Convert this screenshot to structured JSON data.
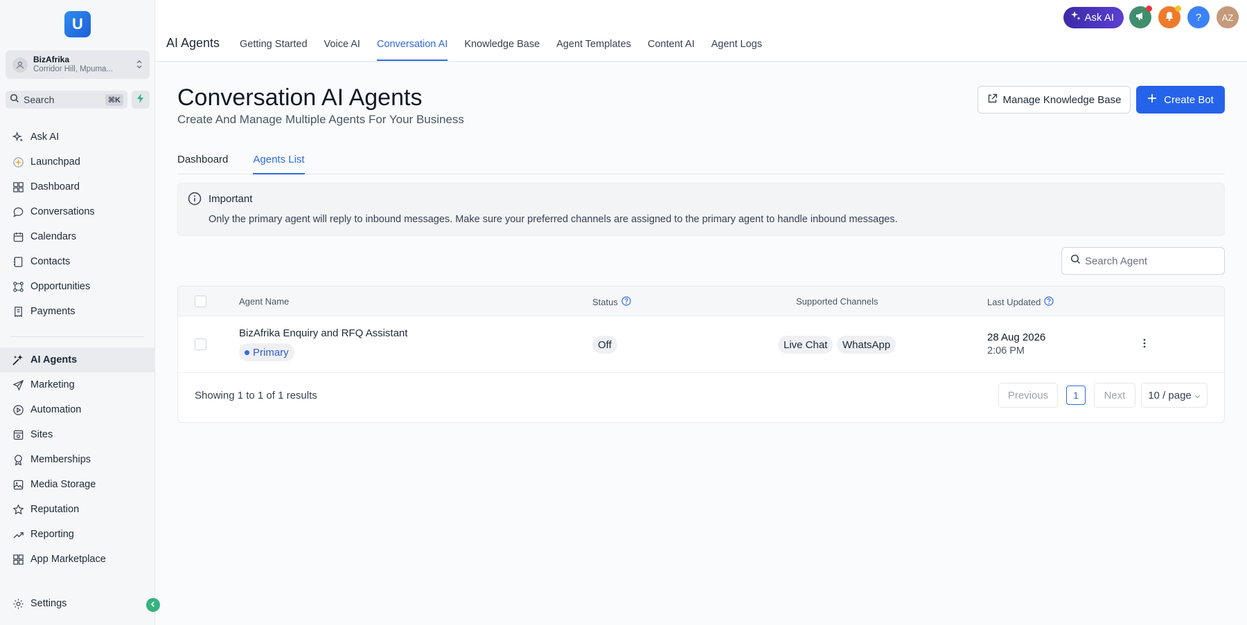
{
  "sidebar": {
    "logo_letter": "U",
    "account": {
      "name": "BizAfrika",
      "location": "Corridor Hill, Mpuma..."
    },
    "search": {
      "label": "Search",
      "shortcut": "⌘K"
    },
    "items_top": [
      {
        "label": "Ask AI",
        "icon": "sparkle-icon"
      },
      {
        "label": "Launchpad",
        "icon": "launchpad-icon"
      },
      {
        "label": "Dashboard",
        "icon": "dashboard-icon"
      },
      {
        "label": "Conversations",
        "icon": "chat-icon"
      },
      {
        "label": "Calendars",
        "icon": "calendar-icon"
      },
      {
        "label": "Contacts",
        "icon": "contacts-icon"
      },
      {
        "label": "Opportunities",
        "icon": "opportunities-icon"
      },
      {
        "label": "Payments",
        "icon": "payments-icon"
      }
    ],
    "items_bottom": [
      {
        "label": "AI Agents",
        "icon": "ai-agents-icon",
        "active": true
      },
      {
        "label": "Marketing",
        "icon": "send-icon"
      },
      {
        "label": "Automation",
        "icon": "automation-icon"
      },
      {
        "label": "Sites",
        "icon": "sites-icon"
      },
      {
        "label": "Memberships",
        "icon": "badge-icon"
      },
      {
        "label": "Media Storage",
        "icon": "image-icon"
      },
      {
        "label": "Reputation",
        "icon": "star-icon"
      },
      {
        "label": "Reporting",
        "icon": "trend-icon"
      },
      {
        "label": "App Marketplace",
        "icon": "grid-icon"
      }
    ],
    "settings_label": "Settings"
  },
  "topbar": {
    "section_title": "AI Agents",
    "tabs": [
      {
        "label": "Getting Started"
      },
      {
        "label": "Voice AI"
      },
      {
        "label": "Conversation AI",
        "active": true
      },
      {
        "label": "Knowledge Base"
      },
      {
        "label": "Agent Templates"
      },
      {
        "label": "Content AI"
      },
      {
        "label": "Agent Logs"
      }
    ],
    "ask_ai_label": "Ask AI",
    "help_label": "?",
    "avatar_initials": "AZ"
  },
  "main": {
    "title": "Conversation AI Agents",
    "subtitle": "Create And Manage Multiple Agents For Your Business",
    "manage_kb_label": "Manage Knowledge Base",
    "create_bot_label": "Create Bot",
    "subtabs": [
      {
        "label": "Dashboard"
      },
      {
        "label": "Agents List",
        "active": true
      }
    ],
    "alert": {
      "title": "Important",
      "text": "Only the primary agent will reply to inbound messages. Make sure your preferred channels are assigned to the primary agent to handle inbound messages."
    },
    "search_placeholder": "Search Agent",
    "table": {
      "headers": {
        "name": "Agent Name",
        "status": "Status",
        "channels": "Supported Channels",
        "updated": "Last Updated"
      },
      "rows": [
        {
          "name": "BizAfrika Enquiry and RFQ Assistant",
          "badge": "Primary",
          "status": "Off",
          "channels": [
            "Live Chat",
            "WhatsApp"
          ],
          "updated_date": "28 Aug 2026",
          "updated_time": "2:06 PM"
        }
      ],
      "results_text": "Showing 1 to 1 of 1 results",
      "pager": {
        "previous": "Previous",
        "page": "1",
        "next": "Next",
        "per_page": "10 / page"
      }
    }
  },
  "colors": {
    "accent": "#2f6ae0",
    "primary_button": "#2563eb",
    "ask_ai_gradient_start": "#3b2aa6",
    "megaphone_button": "#3f8f6f",
    "bell_button": "#f07a2b",
    "help_button": "#3b82f6"
  }
}
